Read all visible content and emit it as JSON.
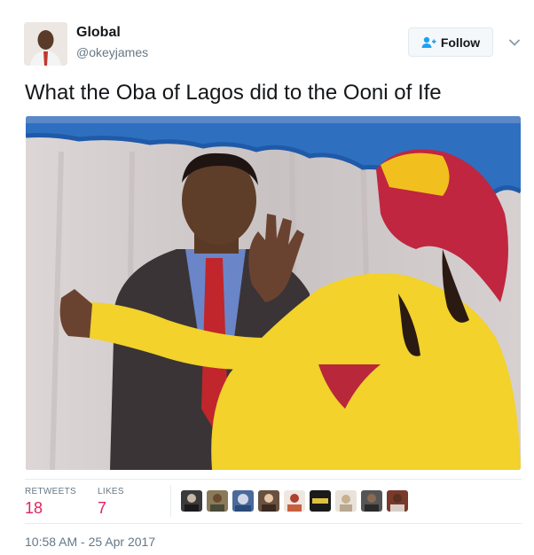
{
  "author": {
    "name": "Global",
    "handle": "@okeyjames",
    "avatar_icon": "profile-photo"
  },
  "follow_button": {
    "label": "Follow",
    "icon": "add-user-icon",
    "accent": "#1da1f2"
  },
  "tweet": {
    "text": "What the Oba of Lagos did to the Ooni of Ife",
    "media_icon": "video-still"
  },
  "stats": {
    "retweets_label": "RETWEETS",
    "retweets_value": "18",
    "likes_label": "LIKES",
    "likes_value": "7",
    "value_color": "#e0245e"
  },
  "likers": [
    {
      "icon": "liker-avatar-1",
      "color": "#3a3a3a"
    },
    {
      "icon": "liker-avatar-2",
      "color": "#8a7a5a"
    },
    {
      "icon": "liker-avatar-3",
      "color": "#4a6a9a"
    },
    {
      "icon": "liker-avatar-4",
      "color": "#6a5040"
    },
    {
      "icon": "liker-avatar-5",
      "color": "#b04030"
    },
    {
      "icon": "liker-avatar-6",
      "color": "#2a2a2a"
    },
    {
      "icon": "liker-avatar-7",
      "color": "#d8cfc0"
    },
    {
      "icon": "liker-avatar-8",
      "color": "#555555"
    },
    {
      "icon": "liker-avatar-9",
      "color": "#7a3a2a"
    }
  ],
  "timestamp": "10:58 AM - 25 Apr 2017"
}
